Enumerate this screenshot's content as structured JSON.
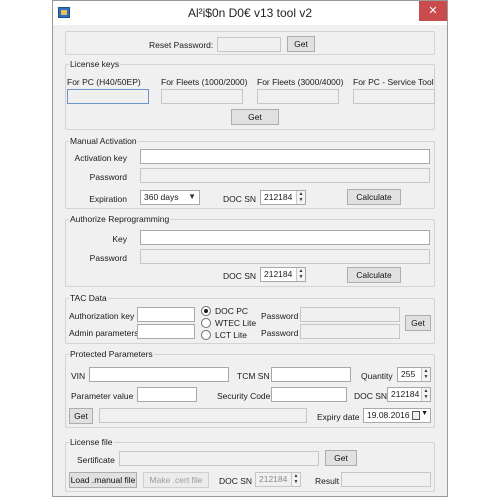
{
  "window": {
    "title": "Al²i$0n D0€ v13 tool v2",
    "close_glyph": "✕"
  },
  "reset": {
    "label": "Reset Password:",
    "value": "",
    "button": "Get"
  },
  "license_keys": {
    "legend": "License keys",
    "columns": [
      "For PC (H40/50EP)",
      "For Fleets (1000/2000)",
      "For Fleets (3000/4000)",
      "For PC - Service Tool"
    ],
    "button": "Get"
  },
  "manual_activation": {
    "legend": "Manual Activation",
    "activation_key_label": "Activation key",
    "password_label": "Password",
    "expiration_label": "Expiration",
    "expiration_value": "360 days",
    "doc_sn_label": "DOC SN",
    "doc_sn_value": "212184",
    "button": "Calculate"
  },
  "authorize_reprogramming": {
    "legend": "Authorize Reprogramming",
    "key_label": "Key",
    "password_label": "Password",
    "doc_sn_label": "DOC SN",
    "doc_sn_value": "212184",
    "button": "Calculate"
  },
  "tac_data": {
    "legend": "TAC Data",
    "authorization_key_label": "Authorization key",
    "admin_parameters_label": "Admin parameters",
    "radio_options": [
      "DOC PC",
      "WTEC Lite",
      "LCT Lite"
    ],
    "selected": "DOC PC",
    "password_label_1": "Password",
    "password_label_2": "Password",
    "button": "Get"
  },
  "protected_parameters": {
    "legend": "Protected Parameters",
    "vin_label": "VIN",
    "tcm_sn_label": "TCM SN",
    "quantity_label": "Quantity",
    "quantity_value": "255",
    "parameter_value_label": "Parameter value",
    "security_code_label": "Security Code",
    "doc_sn_label": "DOC SN",
    "doc_sn_value": "212184",
    "button": "Get",
    "expiry_label": "Expiry date",
    "expiry_value": "19.08.2016"
  },
  "license_file": {
    "legend": "License file",
    "certificate_label": "Sertificate",
    "get_button": "Get",
    "load_button": "Load .manual file",
    "make_button": "Make .cert file",
    "doc_sn_label": "DOC SN",
    "doc_sn_value": "212184",
    "result_label": "Result"
  }
}
